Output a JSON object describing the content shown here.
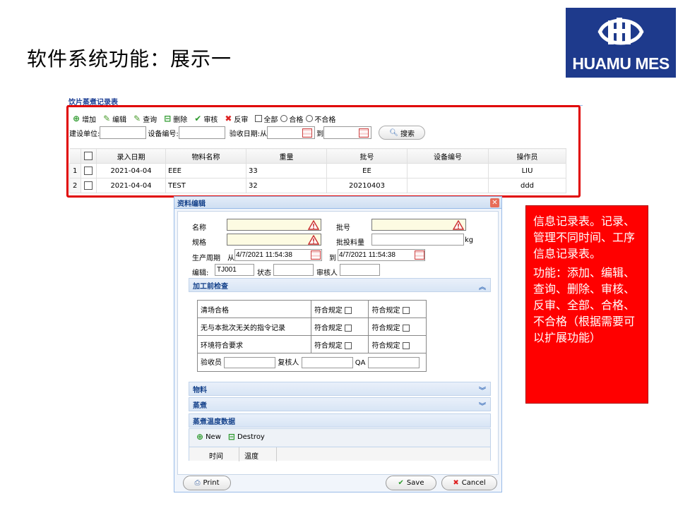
{
  "slide": {
    "title": "软件系统功能：展示一"
  },
  "logo": {
    "text": "HUAMU MES"
  },
  "grid": {
    "title": "饮片蒸煮记录表",
    "toolbar": {
      "add": "增加",
      "edit": "编辑",
      "query": "查询",
      "delete": "删除",
      "audit": "审核",
      "unaudit": "反审",
      "filter_all": "全部",
      "filter_pass": "合格",
      "filter_fail": "不合格"
    },
    "search": {
      "unit_label": "建设单位:",
      "device_label": "设备编号:",
      "date_label": "验收日期:从",
      "to_label": "到",
      "button": "搜索"
    },
    "columns": [
      "录入日期",
      "物料名称",
      "重量",
      "批号",
      "设备编号",
      "操作员"
    ],
    "rows": [
      {
        "no": "1",
        "date": "2021-04-04",
        "material": "EEE",
        "weight": "33",
        "batch": "EE",
        "device": "",
        "operator": "LIU"
      },
      {
        "no": "2",
        "date": "2021-04-04",
        "material": "TEST",
        "weight": "32",
        "batch": "20210403",
        "device": "",
        "operator": "ddd"
      }
    ]
  },
  "dialog": {
    "title": "资料编辑",
    "name_label": "名称",
    "batch_label": "批号",
    "spec_label": "规格",
    "batch_qty_label": "批投料量",
    "unit_kg": "kg",
    "period_label": "生产周期",
    "from_label": "从",
    "from_value": "4/7/2021 11:54:38",
    "to_label": "到",
    "to_value": "4/7/2021 11:54:38",
    "code_label": "编辑:",
    "code_value": "TJ001",
    "status_label": "状态",
    "auditor_label": "审核人",
    "section_precheck": "加工前检查",
    "checks": [
      {
        "item": "清场合格",
        "c1": "符合规定",
        "c2": "符合规定"
      },
      {
        "item": "无与本批次无关的指令记录",
        "c1": "符合规定",
        "c2": "符合规定"
      },
      {
        "item": "环境符合要求",
        "c1": "符合规定",
        "c2": "符合规定"
      }
    ],
    "inspector_label": "验收员",
    "reviewer_label": "复核人",
    "qa_label": "QA",
    "section_material": "物料",
    "section_steam": "蒸煮",
    "section_temp": "蒸煮温度数据",
    "temp_new": "New",
    "temp_destroy": "Destroy",
    "temp_col_time": "时间",
    "temp_col_temp": "温度",
    "print": "Print",
    "save": "Save",
    "cancel": "Cancel"
  },
  "note": {
    "line1": "信息记录表。记录、管理不同时间、工序信息记录表。",
    "line2": "功能：添加、编辑、查询、删除、审核、反审、全部、合格、不合格（根据需要可以扩展功能）"
  },
  "colors": {
    "accent": "#e00000",
    "brand": "#1e3a8c",
    "header_text": "#15428b"
  }
}
